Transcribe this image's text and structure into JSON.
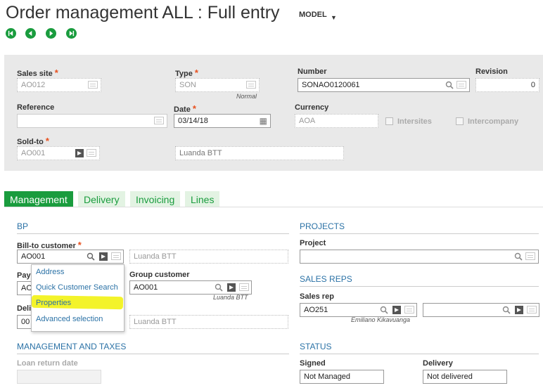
{
  "page": {
    "title": "Order management ALL : Full entry",
    "model_label": "MODEL"
  },
  "header": {
    "sales_site": {
      "label": "Sales site",
      "value": "AO012"
    },
    "type": {
      "label": "Type",
      "value": "SON",
      "sub": "Normal"
    },
    "number": {
      "label": "Number",
      "value": "SONAO0120061"
    },
    "revision": {
      "label": "Revision",
      "value": "0"
    },
    "reference": {
      "label": "Reference",
      "value": ""
    },
    "date": {
      "label": "Date",
      "value": "03/14/18"
    },
    "currency": {
      "label": "Currency",
      "value": "AOA"
    },
    "intersites": {
      "label": "Intersites",
      "checked": false
    },
    "intercompany": {
      "label": "Intercompany",
      "checked": false
    },
    "sold_to": {
      "label": "Sold-to",
      "value": "AO001",
      "name": "Luanda BTT"
    }
  },
  "tabs": [
    {
      "label": "Management",
      "active": true
    },
    {
      "label": "Delivery",
      "active": false
    },
    {
      "label": "Invoicing",
      "active": false
    },
    {
      "label": "Lines",
      "active": false
    }
  ],
  "bp": {
    "section_title": "BP",
    "bill_to": {
      "label": "Bill-to customer",
      "value": "AO001",
      "name": "Luanda BTT"
    },
    "pay_label": "Pay",
    "pay_value": "AO",
    "group_customer": {
      "label": "Group customer",
      "value": "AO001",
      "sub": "Luanda BTT"
    },
    "deli_label": "Deli",
    "deli_value": "00",
    "deli_name": "Luanda BTT"
  },
  "context_menu": {
    "items": [
      "Address",
      "Quick Customer Search",
      "Properties",
      "Advanced selection"
    ]
  },
  "projects": {
    "section_title": "PROJECTS",
    "project_label": "Project",
    "project_value": ""
  },
  "sales_reps": {
    "section_title": "SALES REPS",
    "label": "Sales rep",
    "rep1_value": "AO251",
    "rep1_name": "Emiliano Kikavuanga",
    "rep2_value": ""
  },
  "management_taxes": {
    "section_title": "MANAGEMENT AND TAXES",
    "loan_return_label": "Loan return date",
    "loan_return_value": ""
  },
  "status": {
    "section_title": "STATUS",
    "signed_label": "Signed",
    "signed_value": "Not Managed",
    "delivery_label": "Delivery",
    "delivery_value": "Not delivered"
  },
  "colors": {
    "accent_green": "#1a9c3e",
    "section_blue": "#2b72a6",
    "required_orange": "#e8501e",
    "highlight_yellow": "#f3f32a"
  }
}
